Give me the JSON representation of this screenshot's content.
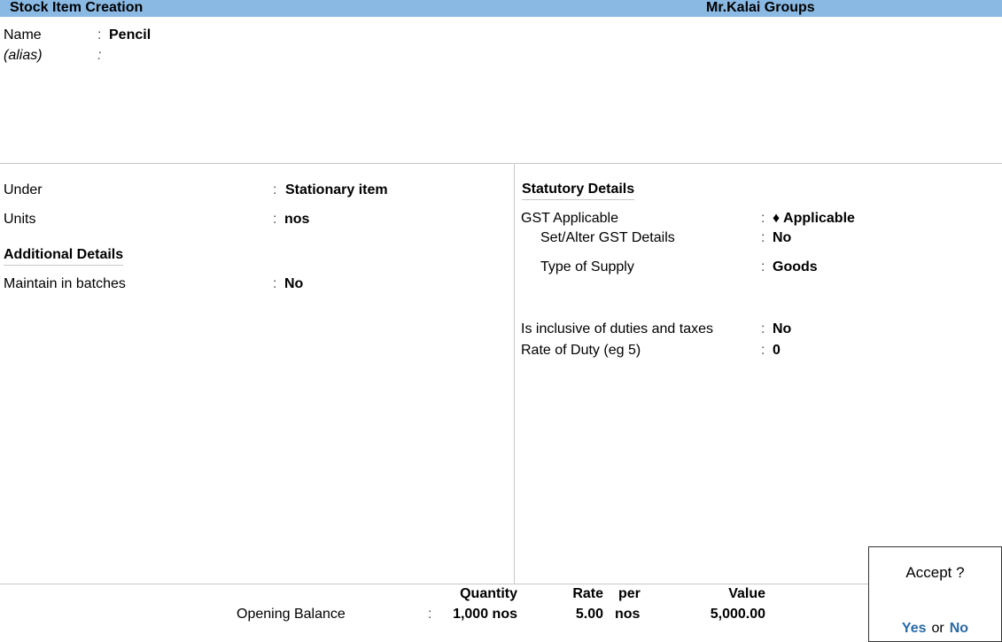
{
  "header": {
    "title": "Stock Item Creation",
    "company": "Mr.Kalai Groups"
  },
  "name_section": {
    "name_label": "Name",
    "name_value": "Pencil",
    "alias_label": "(alias)",
    "alias_value": ""
  },
  "left": {
    "under_label": "Under",
    "under_value": "Stationary item",
    "units_label": "Units",
    "units_value": "nos",
    "additional_heading": "Additional Details",
    "batches_label": "Maintain in batches",
    "batches_value": "No"
  },
  "right": {
    "statutory_heading": "Statutory Details",
    "gst_label": "GST Applicable",
    "gst_value": "♦ Applicable",
    "setalter_label": "Set/Alter GST Details",
    "setalter_value": "No",
    "supply_label": "Type of Supply",
    "supply_value": "Goods",
    "inclusive_label": "Is inclusive of duties and taxes",
    "inclusive_value": "No",
    "rate_label": "Rate of Duty (eg 5)",
    "rate_value": "0"
  },
  "opening": {
    "quantity_header": "Quantity",
    "rate_header": "Rate",
    "per_header": "per",
    "value_header": "Value",
    "label": "Opening Balance",
    "quantity": "1,000 nos",
    "rate": "5.00",
    "per": "nos",
    "value": "5,000.00"
  },
  "accept": {
    "question": "Accept ?",
    "yes": "Yes",
    "or": "or",
    "no": "No"
  },
  "colors": {
    "titlebar": "#8ab9e3",
    "option_blue": "#2b6aa3"
  }
}
